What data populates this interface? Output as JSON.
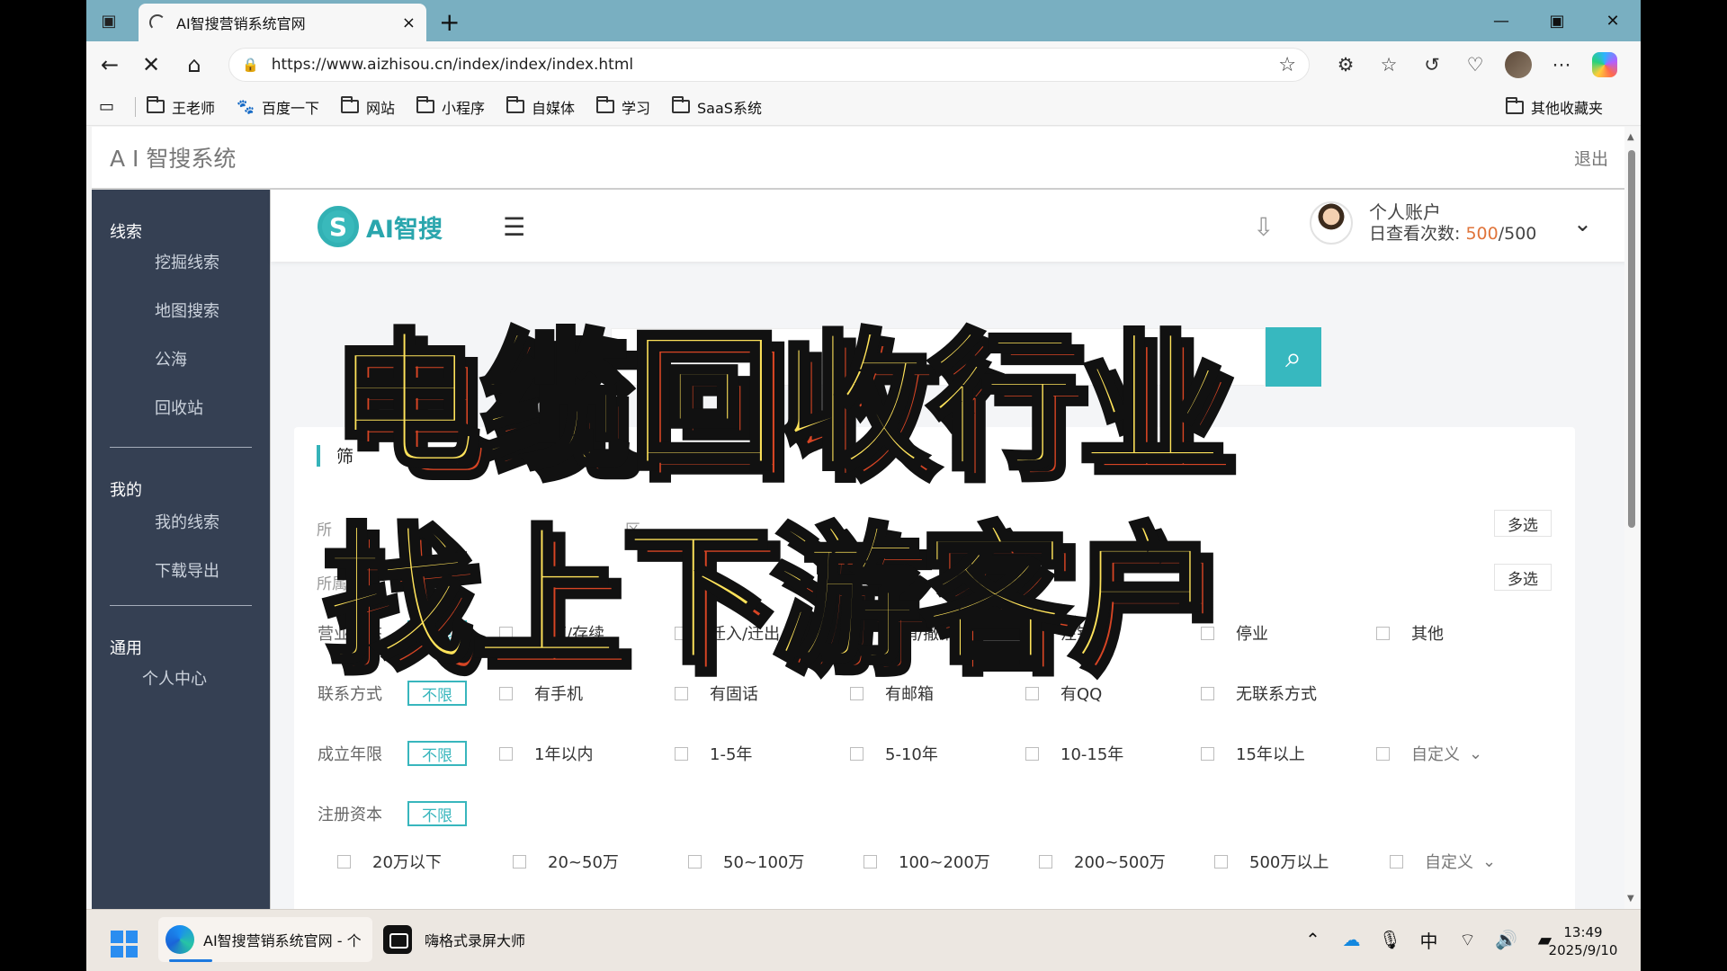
{
  "browser": {
    "tab_title": "AI智搜营销系统官网",
    "url": "https://www.aizhisou.cn/index/index/index.html"
  },
  "bookmarks": {
    "items": [
      "王老师",
      "百度一下",
      "网站",
      "小程序",
      "自媒体",
      "学习",
      "SaaS系统"
    ],
    "other": "其他收藏夹"
  },
  "page": {
    "system_title": "A I 智搜系统",
    "logout": "退出",
    "logo_text": "AI智搜"
  },
  "sidebar": {
    "groups": [
      {
        "title": "线索",
        "items": [
          "挖掘线索",
          "地图搜索",
          "公海",
          "回收站"
        ]
      },
      {
        "title": "我的",
        "items": [
          "我的线索",
          "下载导出"
        ]
      },
      {
        "title": "通用",
        "items": [
          "个人中心"
        ]
      }
    ]
  },
  "account": {
    "label": "个人账户",
    "quota_label": "日查看次数: ",
    "used": "500",
    "total": "/500"
  },
  "filters": {
    "partial_title": "筛",
    "partial_row1": "所",
    "partial_row2": "所属",
    "region_hint": "区",
    "multi_select": "多选",
    "unlimited": "不限",
    "rows": [
      {
        "label": "营业状态",
        "options": [
          "在营/存续",
          "迁入/迁出",
          "吊销/撤销",
          "注销",
          "停业",
          "其他"
        ]
      },
      {
        "label": "联系方式",
        "options": [
          "有手机",
          "有固话",
          "有邮箱",
          "有QQ",
          "无联系方式"
        ]
      },
      {
        "label": "成立年限",
        "options": [
          "1年以内",
          "1-5年",
          "5-10年",
          "10-15年",
          "15年以上",
          "自定义"
        ]
      },
      {
        "label": "注册资本",
        "options": [
          "20万以下",
          "20~50万",
          "50~100万",
          "100~200万",
          "200~500万",
          "500万以上",
          "自定义"
        ]
      }
    ]
  },
  "overlay": {
    "line1": "电缆回收行业",
    "line2": "找上下游客户"
  },
  "taskbar": {
    "edge_title": "AI智搜营销系统官网 - 个",
    "recorder_title": "嗨格式录屏大师",
    "ime": "中",
    "time": "13:49",
    "date": "2025/9/10"
  },
  "icons": [
    "tab-actions-icon",
    "loading-spinner-icon",
    "close-icon",
    "plus-icon",
    "back-icon",
    "stop-icon",
    "home-icon",
    "lock-icon",
    "star-icon",
    "extensions-icon",
    "favorites-icon",
    "history-icon",
    "health-icon",
    "more-icon",
    "folder-icon",
    "menu-toggle-icon",
    "download-icon",
    "chevron-down-icon",
    "search-icon",
    "windows-start-icon",
    "cloud-icon",
    "microphone-icon",
    "wifi-icon",
    "volume-icon",
    "battery-icon"
  ]
}
